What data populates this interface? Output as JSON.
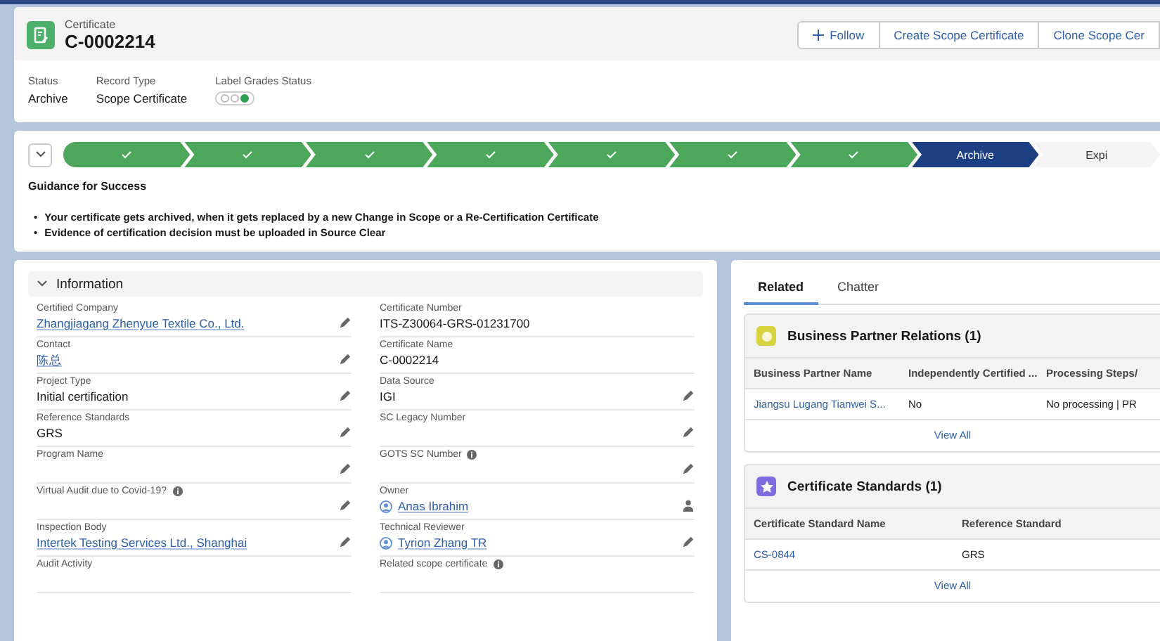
{
  "header": {
    "object_type": "Certificate",
    "title": "C-0002214",
    "actions": [
      {
        "label": "Follow"
      },
      {
        "label": "Create Scope Certificate"
      },
      {
        "label": "Clone Scope Cer"
      }
    ],
    "highlights": [
      {
        "label": "Status",
        "value": "Archive",
        "kind": "text"
      },
      {
        "label": "Record Type",
        "value": "Scope Certificate",
        "kind": "text"
      },
      {
        "label": "Label Grades Status",
        "kind": "dots",
        "dots": [
          {
            "filled": false
          },
          {
            "filled": false
          },
          {
            "filled": true
          }
        ]
      }
    ]
  },
  "path": {
    "stages": [
      {
        "completed": true,
        "selected": false
      },
      {
        "completed": true,
        "selected": false
      },
      {
        "completed": true,
        "selected": false
      },
      {
        "completed": true,
        "selected": false
      },
      {
        "completed": true,
        "selected": false
      },
      {
        "completed": true,
        "selected": false
      },
      {
        "completed": true,
        "selected": false
      },
      {
        "label": "Archive",
        "completed": false,
        "selected": true
      },
      {
        "label": "Expi",
        "completed": false,
        "selected": false
      }
    ],
    "guidance_title": "Guidance for Success",
    "guidance": [
      {
        "bullet": "•",
        "text": "Your certificate gets archived, when it gets replaced by a new Change in Scope or a Re-Certification Certificate"
      },
      {
        "bullet": "•",
        "text": "Evidence of certification decision must be uploaded in Source Clear"
      }
    ]
  },
  "information": {
    "title": "Information",
    "expanded": true,
    "rows": [
      [
        {
          "label": "Certified Company",
          "value": "Zhangjiagang Zhenyue Textile Co., Ltd.",
          "kind": "link",
          "editable": true
        },
        {
          "label": "Certificate Number",
          "value": "ITS-Z30064-GRS-01231700",
          "kind": "text",
          "editable": false
        }
      ],
      [
        {
          "label": "Contact",
          "value": "陈总",
          "kind": "link",
          "editable": true
        },
        {
          "label": "Certificate Name",
          "value": "C-0002214",
          "kind": "text",
          "editable": false
        }
      ],
      [
        {
          "label": "Project Type",
          "value": "Initial certification",
          "kind": "text",
          "editable": true
        },
        {
          "label": "Data Source",
          "value": "IGI",
          "kind": "text",
          "editable": true
        }
      ],
      [
        {
          "label": "Reference Standards",
          "value": "GRS",
          "kind": "text",
          "editable": true
        },
        {
          "label": "SC Legacy Number",
          "kind": "text",
          "editable": true
        }
      ],
      [
        {
          "label": "Program Name",
          "kind": "text",
          "editable": true
        },
        {
          "label": "GOTS SC Number",
          "info": true,
          "kind": "text",
          "editable": true
        }
      ],
      [
        {
          "label": "Virtual Audit due to Covid-19?",
          "info": true,
          "kind": "text",
          "editable": true
        },
        {
          "label": "Owner",
          "value": "Anas Ibrahim",
          "kind": "owner",
          "editable": true
        }
      ],
      [
        {
          "label": "Inspection Body",
          "value": "Intertek Testing Services Ltd., Shanghai",
          "kind": "link",
          "editable": true
        },
        {
          "label": "Technical Reviewer",
          "value": "Tyrion Zhang TR",
          "kind": "user",
          "editable": true
        }
      ],
      [
        {
          "label": "Audit Activity",
          "kind": "text",
          "editable": false
        },
        {
          "label": "Related scope certificate",
          "info": true,
          "kind": "text",
          "editable": false
        }
      ]
    ]
  },
  "tabs": [
    {
      "label": "Related",
      "selected": true
    },
    {
      "label": "Chatter",
      "selected": false
    }
  ],
  "related_lists": [
    {
      "title": "Business Partner Relations (1)",
      "color": "#d6d33f",
      "columns": [
        "Business Partner Name",
        "Independently Certified ...",
        "Processing Steps/"
      ],
      "rows": [
        [
          {
            "value": "Jiangsu Lugang Tianwei S...",
            "kind": "link"
          },
          {
            "value": "No",
            "kind": "text"
          },
          {
            "value": "No processing | PR",
            "kind": "text"
          }
        ]
      ],
      "footer": "View All"
    },
    {
      "title": "Certificate Standards (1)",
      "color": "#7d6be0",
      "columns": [
        "Certificate Standard Name",
        "Reference Standard"
      ],
      "rows": [
        [
          {
            "value": "CS-0844",
            "kind": "link"
          },
          {
            "value": "GRS",
            "kind": "text"
          }
        ]
      ],
      "footer": "View All"
    }
  ]
}
